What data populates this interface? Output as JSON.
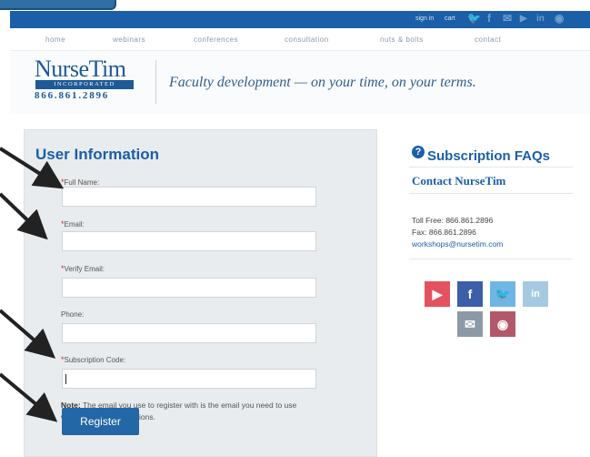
{
  "topbar": {
    "sign_in": "sign in",
    "cart": "cart",
    "social_icons": [
      "twitter-icon",
      "facebook-icon",
      "email-icon",
      "youtube-icon",
      "linkedin-icon",
      "rss-icon"
    ],
    "social_glyphs": {
      "twitter": "🐦",
      "facebook": "f",
      "email": "✉",
      "youtube": "▶",
      "linkedin": "in",
      "rss": "◉"
    }
  },
  "nav": {
    "items": [
      "home",
      "webinars",
      "conferences",
      "consultation",
      "nuts & bolts",
      "contact"
    ]
  },
  "header": {
    "logo_name": "NurseTim",
    "logo_band": "INCORPORATED",
    "logo_phone": "866.861.2896",
    "tagline": "Faculty development — on your time, on your terms."
  },
  "form": {
    "title": "User Information",
    "required_mark": "*",
    "fields": [
      {
        "label": "Full Name:",
        "required": true,
        "value": ""
      },
      {
        "label": "Email:",
        "required": true,
        "value": ""
      },
      {
        "label": "Verify Email:",
        "required": true,
        "value": ""
      },
      {
        "label": "Phone:",
        "required": false,
        "value": ""
      },
      {
        "label": "Subscription Code:",
        "required": true,
        "value": ""
      }
    ],
    "note_bold": "Note:",
    "note_text": " The email you use to register with is the email you need to use when filling out evaluations.",
    "register_label": "Register"
  },
  "sidebar": {
    "faq_icon_glyph": "?",
    "faq_title": "Subscription FAQs",
    "contact_title": "Contact NurseTim",
    "toll_free": "Toll Free: 866.861.2896",
    "fax": "Fax: 866.861.2896",
    "email": "workshops@nursetim.com",
    "social_tiles": [
      {
        "icon": "youtube-icon",
        "glyph": "▶",
        "color": "#e2535f"
      },
      {
        "icon": "facebook-icon",
        "glyph": "f",
        "color": "#3d5ea8"
      },
      {
        "icon": "twitter-icon",
        "glyph": "🐦",
        "color": "#6fb6e6"
      },
      {
        "icon": "linkedin-icon",
        "glyph": "in",
        "color": "#a6c9e2"
      },
      {
        "icon": "email-icon",
        "glyph": "✉",
        "color": "#8c9aa8"
      },
      {
        "icon": "rss-icon",
        "glyph": "◉",
        "color": "#b2586a"
      }
    ]
  },
  "colors": {
    "brand_blue": "#1b5fa8",
    "required_red": "#c4302b",
    "panel_bg": "#e9ecee"
  }
}
